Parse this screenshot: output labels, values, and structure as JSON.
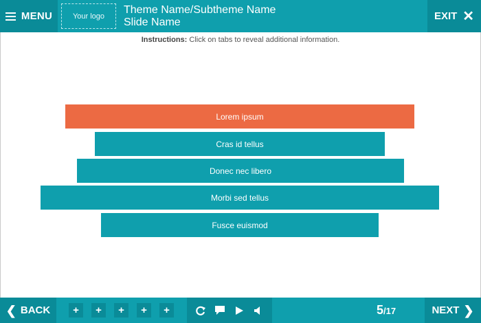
{
  "header": {
    "menu_label": "MENU",
    "logo_text": "Your logo",
    "theme_title": "Theme Name/Subtheme Name",
    "slide_title": "Slide Name",
    "exit_label": "EXIT"
  },
  "instructions": {
    "label": "Instructions:",
    "text": " Click on tabs to reveal additional information."
  },
  "tabs": [
    {
      "label": "Lorem ipsum",
      "active": true
    },
    {
      "label": "Cras id tellus",
      "active": false
    },
    {
      "label": "Donec nec libero",
      "active": false
    },
    {
      "label": "Morbi sed tellus",
      "active": false
    },
    {
      "label": "Fusce euismod",
      "active": false
    }
  ],
  "footer": {
    "back_label": "BACK",
    "next_label": "NEXT",
    "plus_buttons": [
      "+",
      "+",
      "+",
      "+",
      "+"
    ],
    "current_page": "5",
    "total_pages": "/17"
  },
  "colors": {
    "teal": "#0f9fad",
    "teal_dark": "#0a8b98",
    "active_tab": "#ec6a43"
  },
  "icons": {
    "menu": "hamburger-icon",
    "exit": "close-icon",
    "back": "chevron-left-icon",
    "next": "chevron-right-icon",
    "replay": "replay-icon",
    "notes": "comment-icon",
    "play": "play-icon",
    "audio": "speaker-icon"
  }
}
